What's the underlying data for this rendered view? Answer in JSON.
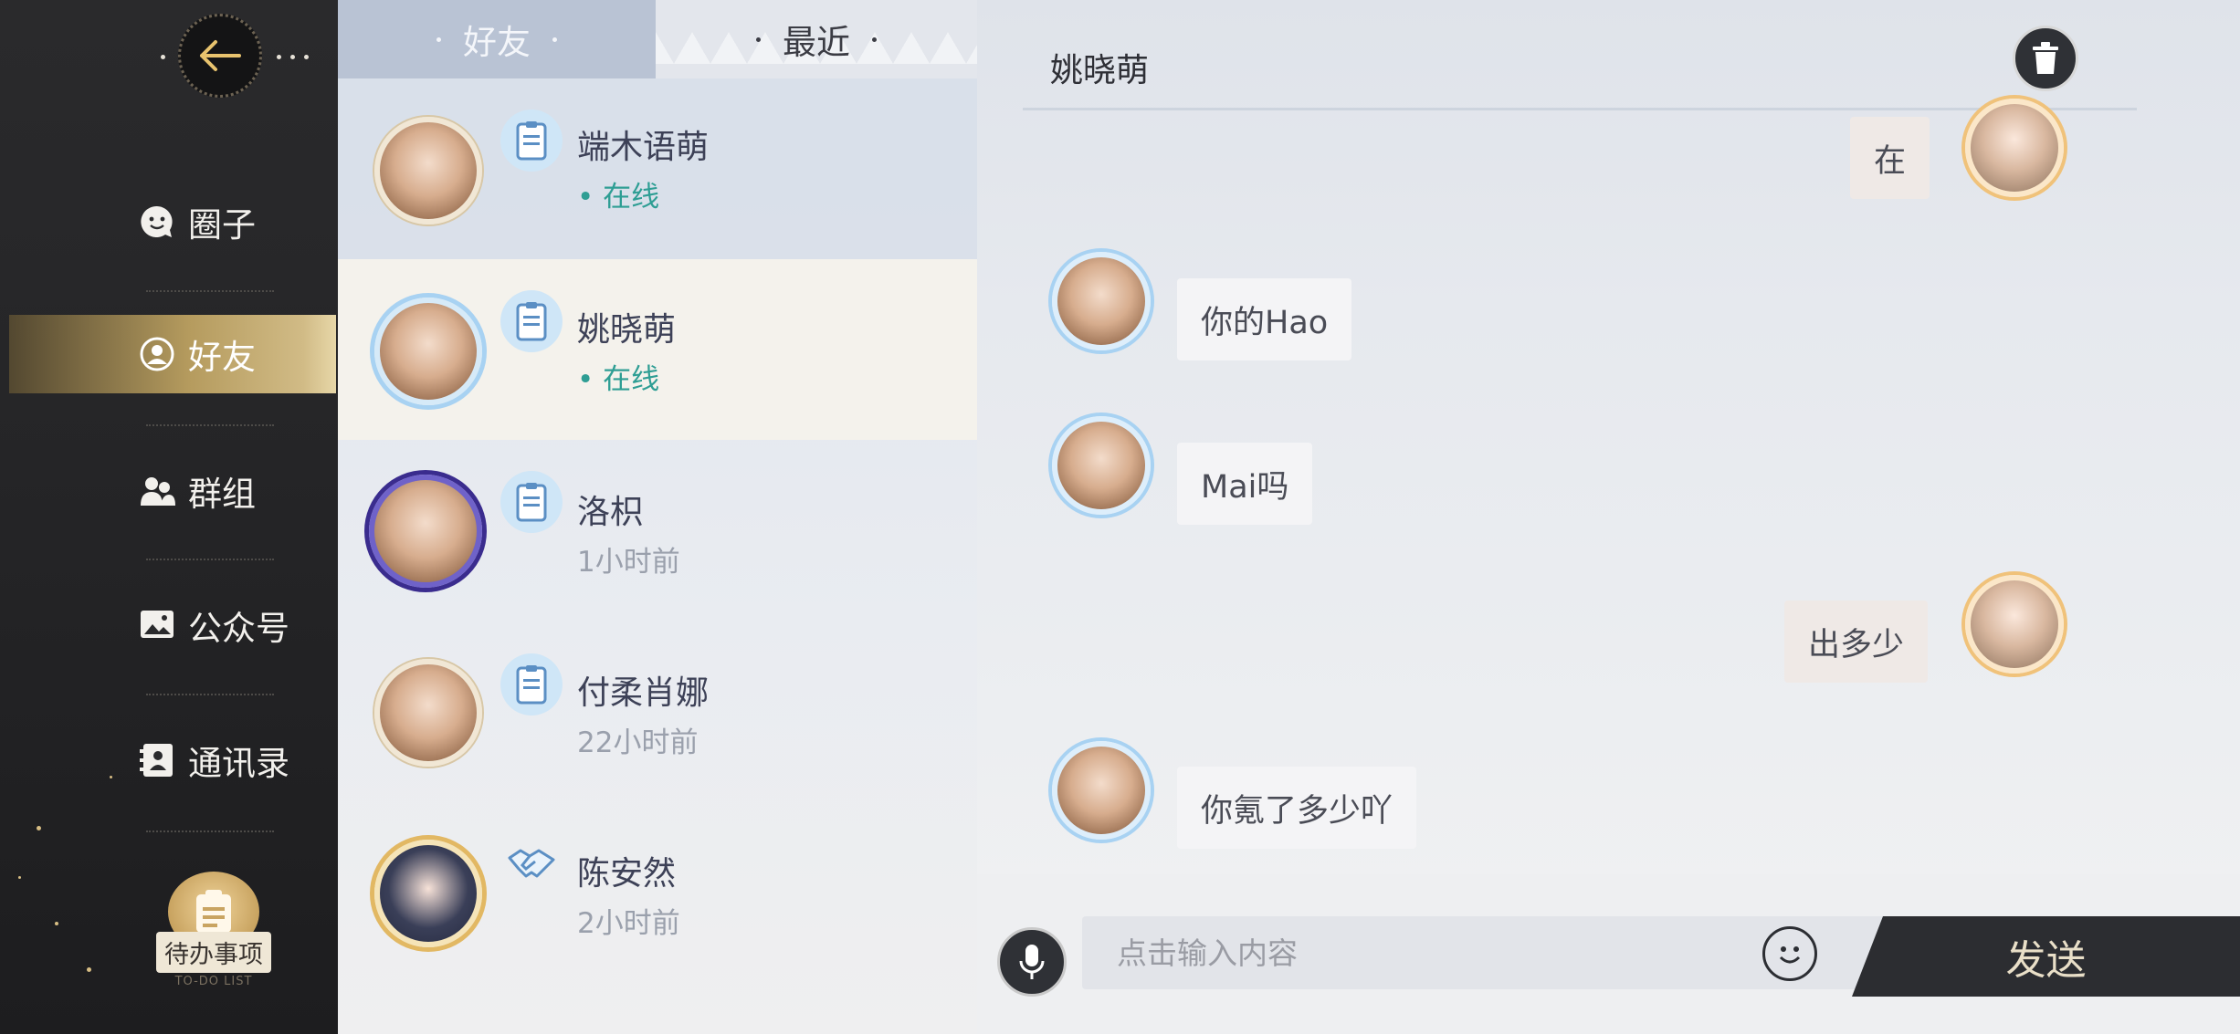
{
  "nav": {
    "items": [
      {
        "label": "圈子",
        "icon": "smile-chat-icon",
        "active": false
      },
      {
        "label": "好友",
        "icon": "friend-icon",
        "active": true
      },
      {
        "label": "群组",
        "icon": "group-icon",
        "active": false
      },
      {
        "label": "公众号",
        "icon": "picture-icon",
        "active": false
      },
      {
        "label": "通讯录",
        "icon": "contacts-icon",
        "active": false
      }
    ],
    "todo_label": "待办事项",
    "todo_sub": "TO-DO LIST"
  },
  "list": {
    "tabs": [
      {
        "label": "好友",
        "active": true
      },
      {
        "label": "最近",
        "active": false
      }
    ],
    "friends": [
      {
        "name": "端木语萌",
        "status": "在线",
        "online": true,
        "icon": "notebook-icon"
      },
      {
        "name": "姚晓萌",
        "status": "在线",
        "online": true,
        "icon": "notebook-icon"
      },
      {
        "name": "洛枳",
        "status": "1小时前",
        "online": false,
        "icon": "notebook-icon"
      },
      {
        "name": "付柔肖娜",
        "status": "22小时前",
        "online": false,
        "icon": "notebook-icon"
      },
      {
        "name": "陈安然",
        "status": "2小时前",
        "online": false,
        "icon": "handshake-icon"
      }
    ]
  },
  "chat": {
    "title": "姚晓萌",
    "messages": [
      {
        "text": "在",
        "from": "me"
      },
      {
        "text": "你的Hao",
        "from": "them"
      },
      {
        "text": "Mai吗",
        "from": "them"
      },
      {
        "text": "出多少",
        "from": "me"
      },
      {
        "text": "你氪了多少吖",
        "from": "them"
      }
    ],
    "input_placeholder": "点击输入内容",
    "send_label": "发送"
  },
  "colors": {
    "accent_gold": "#b59b5e",
    "online_green": "#2e9e94",
    "dark": "#2c2d31"
  }
}
